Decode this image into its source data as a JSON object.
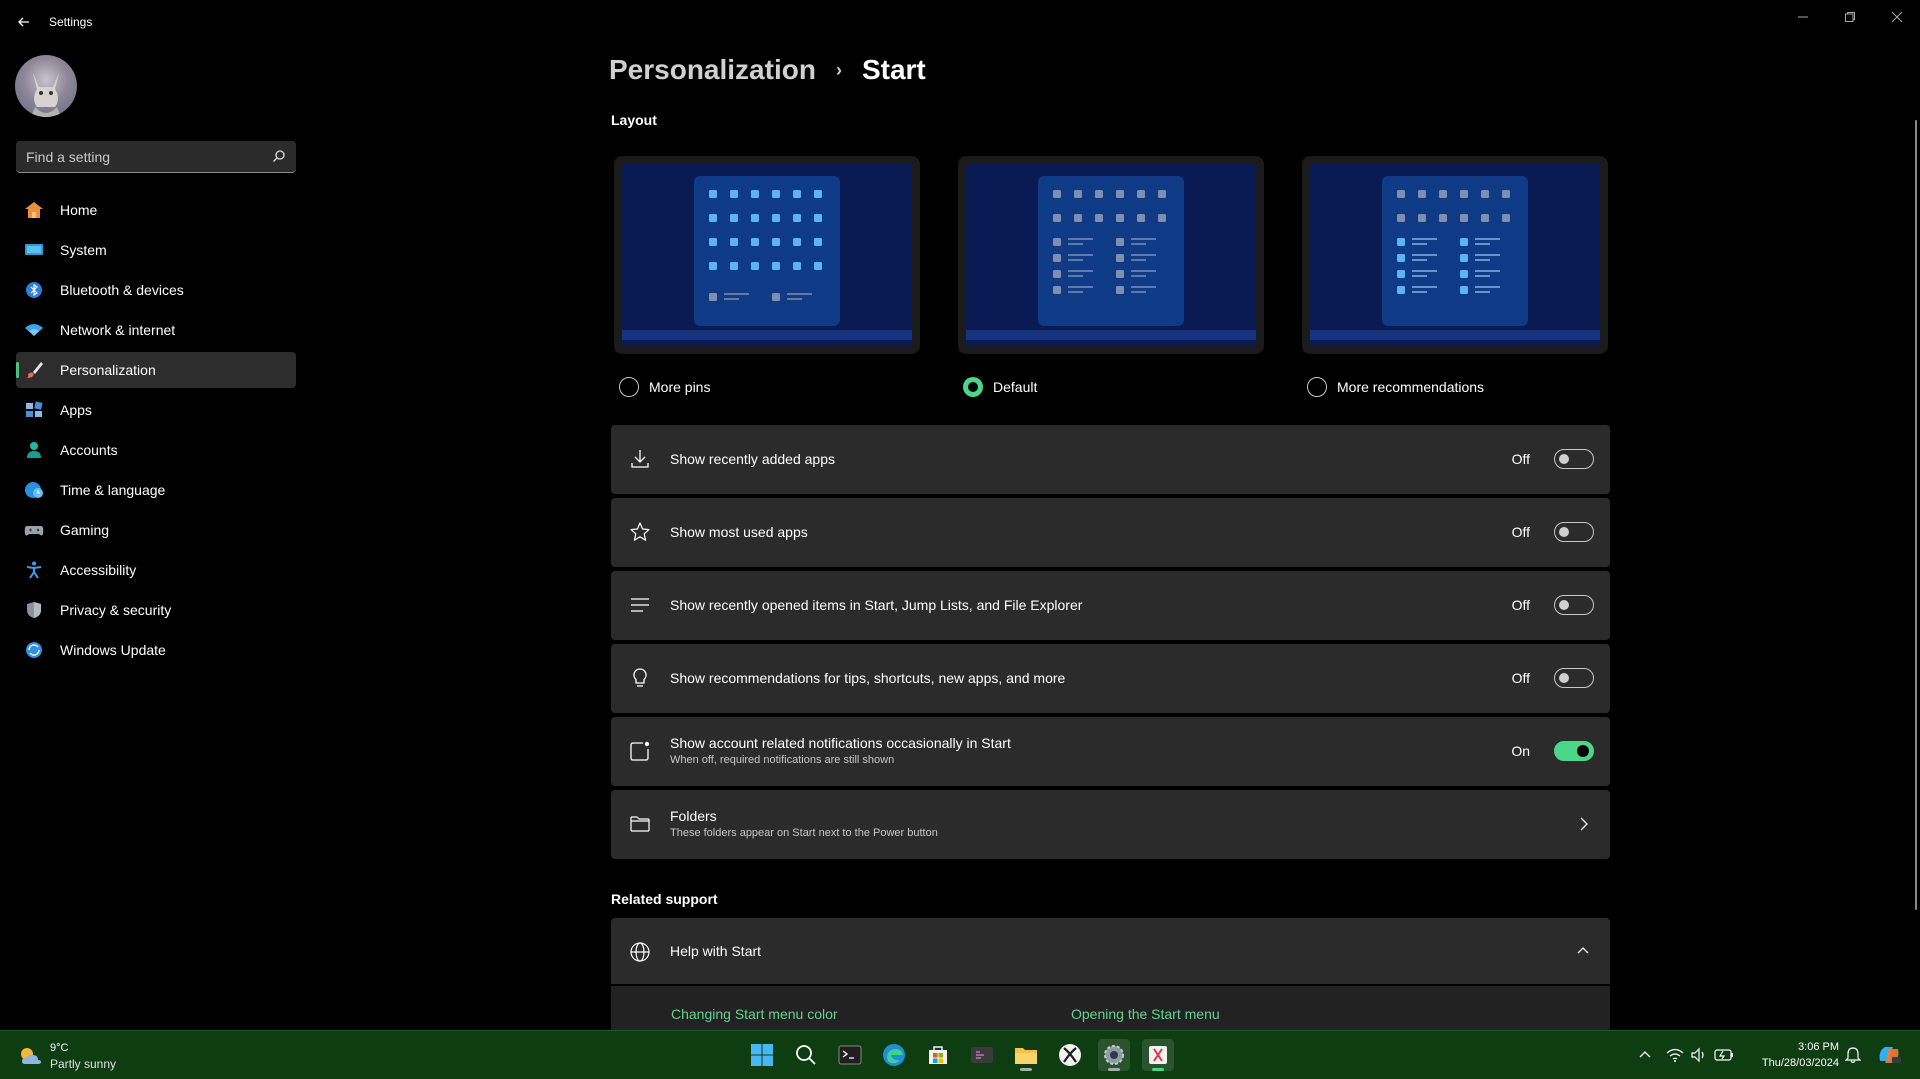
{
  "window": {
    "title": "Settings",
    "controls": [
      "minimize-icon",
      "restore-icon",
      "close-icon"
    ]
  },
  "sidebar": {
    "search": {
      "placeholder": "Find a setting",
      "value": ""
    },
    "items": [
      {
        "label": "Home",
        "icon": "home-icon"
      },
      {
        "label": "System",
        "icon": "monitor-icon"
      },
      {
        "label": "Bluetooth & devices",
        "icon": "bluetooth-icon"
      },
      {
        "label": "Network & internet",
        "icon": "wifi-icon"
      },
      {
        "label": "Personalization",
        "icon": "brush-icon",
        "active": true
      },
      {
        "label": "Apps",
        "icon": "apps-icon"
      },
      {
        "label": "Accounts",
        "icon": "person-icon"
      },
      {
        "label": "Time & language",
        "icon": "globe-clock-icon"
      },
      {
        "label": "Gaming",
        "icon": "gamepad-icon"
      },
      {
        "label": "Accessibility",
        "icon": "accessibility-icon"
      },
      {
        "label": "Privacy & security",
        "icon": "shield-icon"
      },
      {
        "label": "Windows Update",
        "icon": "update-icon"
      }
    ]
  },
  "breadcrumb": {
    "parent": "Personalization",
    "current": "Start"
  },
  "layout": {
    "heading": "Layout",
    "options": [
      {
        "label": "More pins",
        "selected": false
      },
      {
        "label": "Default",
        "selected": true
      },
      {
        "label": "More recommendations",
        "selected": false
      }
    ]
  },
  "settings": [
    {
      "title": "Show recently added apps",
      "subtitle": "",
      "state": "Off",
      "on": false,
      "icon": "download-icon"
    },
    {
      "title": "Show most used apps",
      "subtitle": "",
      "state": "Off",
      "on": false,
      "icon": "star-icon"
    },
    {
      "title": "Show recently opened items in Start, Jump Lists, and File Explorer",
      "subtitle": "",
      "state": "Off",
      "on": false,
      "icon": "list-icon"
    },
    {
      "title": "Show recommendations for tips, shortcuts, new apps, and more",
      "subtitle": "",
      "state": "Off",
      "on": false,
      "icon": "lightbulb-icon"
    },
    {
      "title": "Show account related notifications occasionally in Start",
      "subtitle": "When off, required notifications are still shown",
      "state": "On",
      "on": true,
      "icon": "notification-icon"
    }
  ],
  "folders": {
    "title": "Folders",
    "subtitle": "These folders appear on Start next to the Power button",
    "icon": "folder-icon"
  },
  "related_support": {
    "heading": "Related support",
    "help_title": "Help with Start",
    "links": [
      "Changing Start menu color",
      "Opening the Start menu"
    ]
  },
  "taskbar": {
    "weather": {
      "temp": "9°C",
      "desc": "Partly sunny"
    },
    "apps": [
      "windows-start-icon",
      "search-icon",
      "terminal-icon",
      "edge-icon",
      "store-icon",
      "devhome-icon",
      "file-explorer-icon",
      "xbox-icon",
      "settings-icon",
      "snipping-tool-icon"
    ],
    "time": "3:06 PM",
    "date": "Thu/28/03/2024"
  },
  "colors": {
    "accent": "#4cd68a",
    "link": "#5dd68f",
    "card": "#2b2b2b",
    "taskbar": "#0e3d12"
  }
}
